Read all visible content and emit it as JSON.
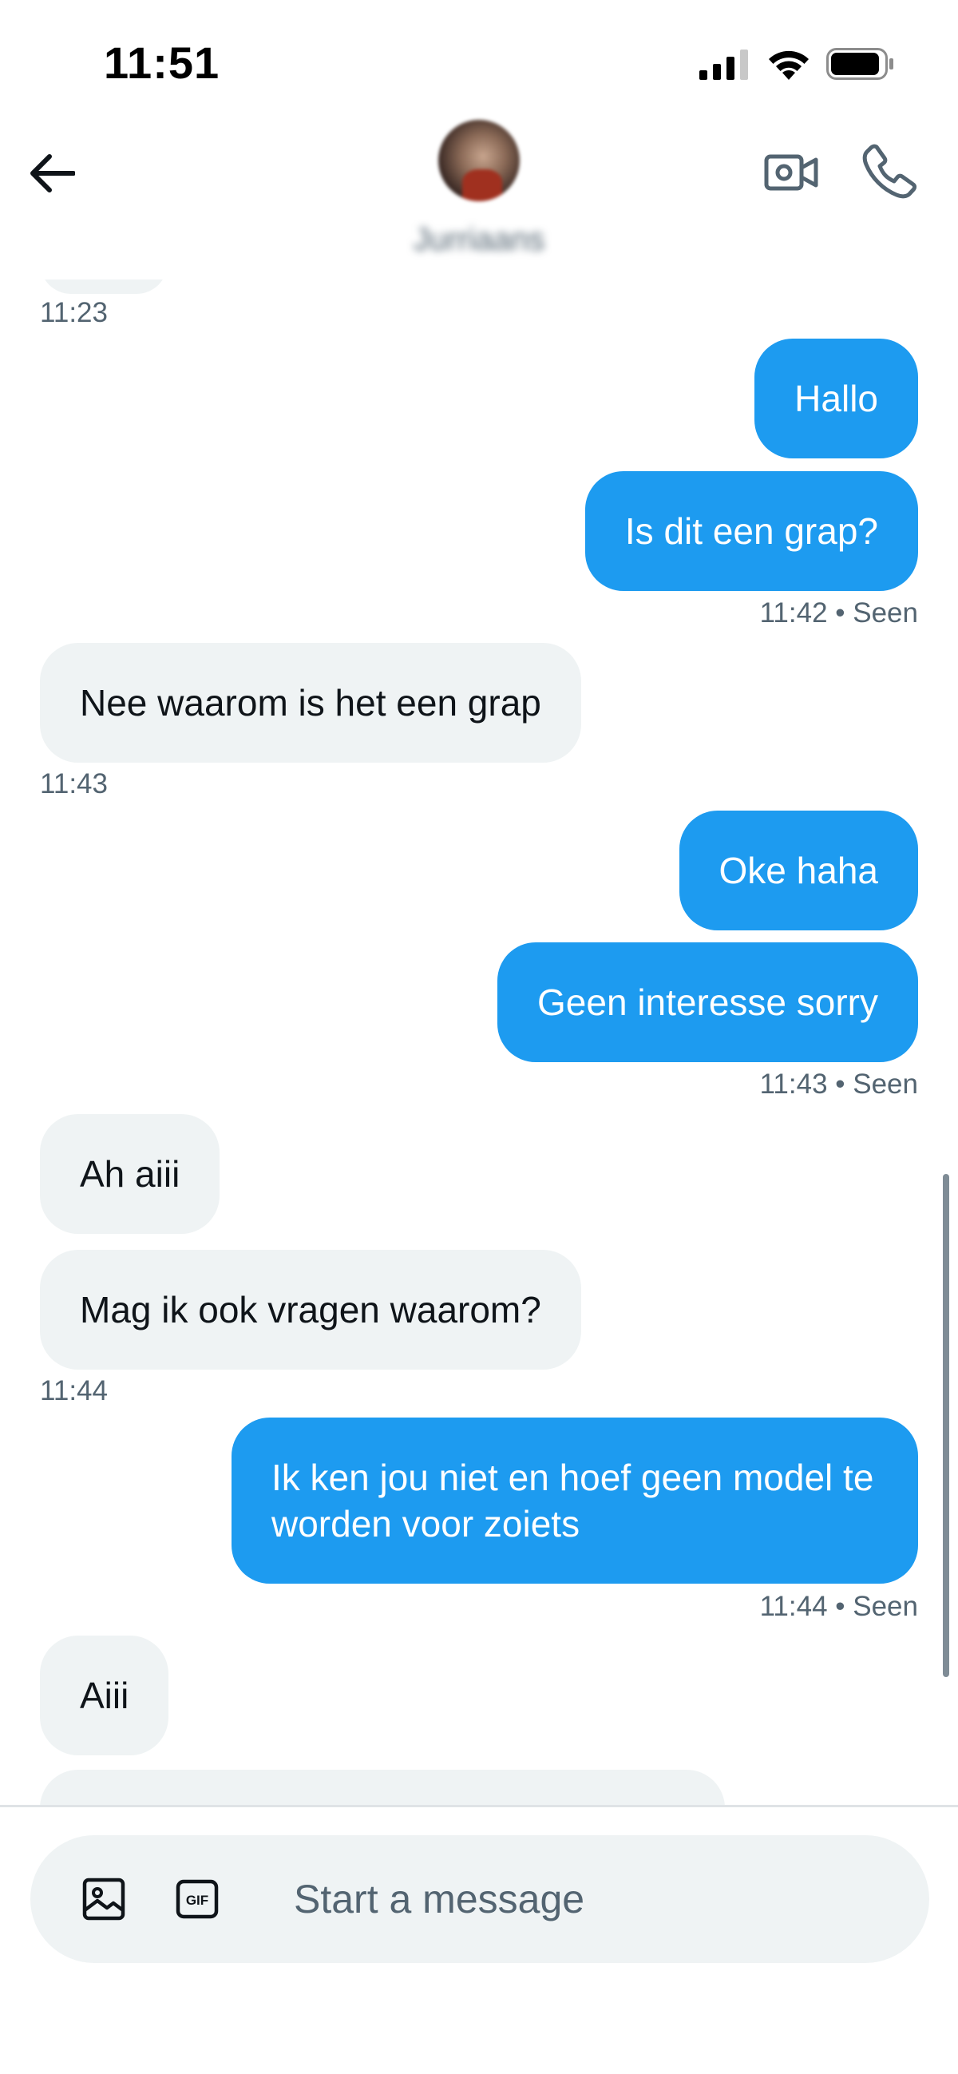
{
  "status_bar": {
    "time": "11:51"
  },
  "header": {
    "contact_name": "Jurriaans"
  },
  "messages": [
    {
      "timestamp": "11:23"
    },
    {
      "text": "Hallo"
    },
    {
      "text": "Is dit een grap?",
      "meta": "11:42 • Seen"
    },
    {
      "text": "Nee waarom is het een grap",
      "meta": "11:43"
    },
    {
      "text": "Oke haha"
    },
    {
      "text": "Geen interesse sorry",
      "meta": "11:43 • Seen"
    },
    {
      "text": "Ah aiii"
    },
    {
      "text": "Mag ik ook vragen waarom?",
      "meta": "11:44"
    },
    {
      "text": "Ik ken jou niet en hoef geen model te worden voor zoiets",
      "meta": "11:44 • Seen"
    },
    {
      "text": "Aiii"
    }
  ],
  "composer": {
    "placeholder": "Start a message"
  },
  "icons": {
    "back": "arrow-left-icon",
    "video": "video-camera-icon",
    "call": "phone-icon",
    "media": "image-icon",
    "gif": "gif-icon",
    "voice": "voice-waveform-icon"
  },
  "colors": {
    "outgoing_bubble": "#1d9bf0",
    "incoming_bubble": "#eff3f4",
    "secondary_text": "#536471",
    "voice_accent": "#7856ff"
  }
}
